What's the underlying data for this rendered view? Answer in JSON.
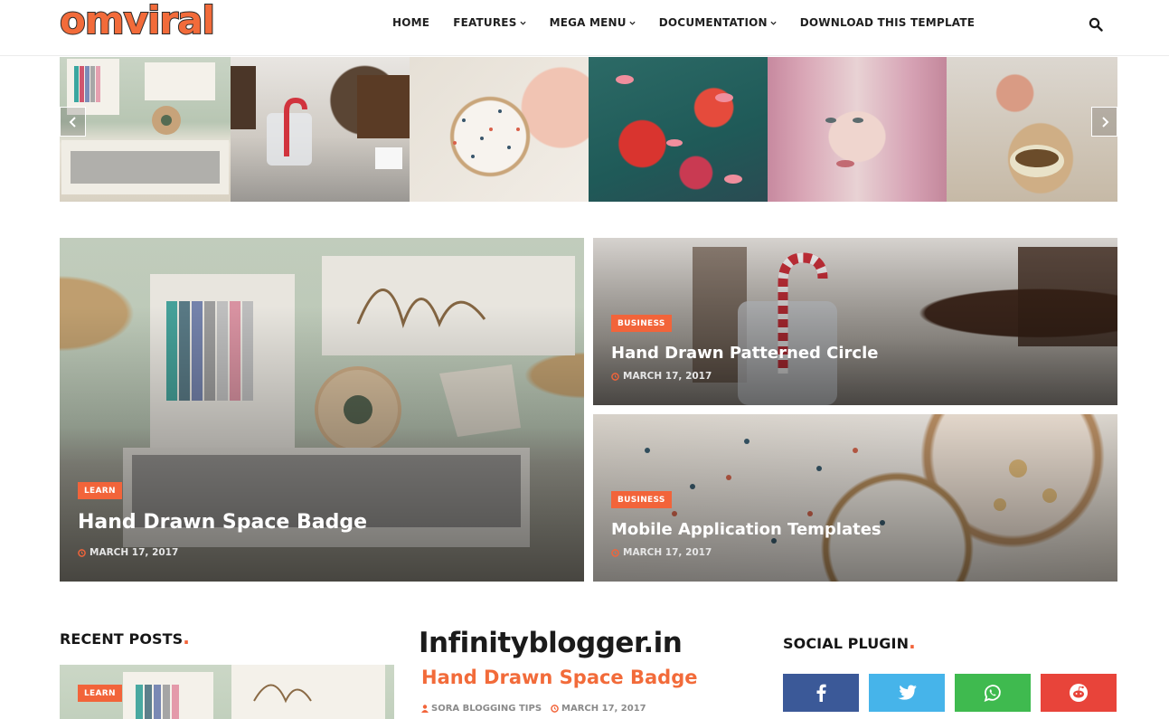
{
  "header": {
    "logo": "omviral",
    "nav": [
      {
        "label": "HOME",
        "has_dropdown": false
      },
      {
        "label": "FEATURES",
        "has_dropdown": true
      },
      {
        "label": "MEGA MENU",
        "has_dropdown": true
      },
      {
        "label": "DOCUMENTATION",
        "has_dropdown": true
      },
      {
        "label": "DOWNLOAD THIS TEMPLATE",
        "has_dropdown": false
      }
    ],
    "search_icon": "search-icon"
  },
  "carousel": {
    "prev_icon": "chevron-left-icon",
    "next_icon": "chevron-right-icon",
    "slides": [
      "craft-wall-art",
      "candy-cane-cake",
      "dragonfly-embroidery",
      "coral-fish-pattern",
      "pink-hair-portrait",
      "wrapped-sandwich"
    ]
  },
  "featured": [
    {
      "tag": "LEARN",
      "title": "Hand Drawn Space Badge",
      "date": "MARCH 17, 2017"
    },
    {
      "tag": "BUSINESS",
      "title": "Hand Drawn Patterned Circle",
      "date": "MARCH 17, 2017"
    },
    {
      "tag": "BUSINESS",
      "title": "Mobile Application Templates",
      "date": "MARCH 17, 2017"
    }
  ],
  "recent_posts": {
    "title": "RECENT POSTS",
    "dot": ".",
    "first_tag": "LEARN"
  },
  "center_post": {
    "banner": "Infinityblogger.in",
    "title": "Hand Drawn Space Badge",
    "author": "SORA BLOGGING TIPS",
    "date": "MARCH 17, 2017"
  },
  "social_plugin": {
    "title": "SOCIAL PLUGIN",
    "dot": ".",
    "buttons": [
      {
        "network": "facebook",
        "icon": "facebook-icon",
        "color": "#3b5998"
      },
      {
        "network": "twitter",
        "icon": "twitter-icon",
        "color": "#46b4ea"
      },
      {
        "network": "whatsapp",
        "icon": "whatsapp-icon",
        "color": "#3fba4f"
      },
      {
        "network": "reddit",
        "icon": "reddit-icon",
        "color": "#e8443a"
      }
    ]
  },
  "colors": {
    "accent": "#f2643a",
    "text": "#161616"
  }
}
